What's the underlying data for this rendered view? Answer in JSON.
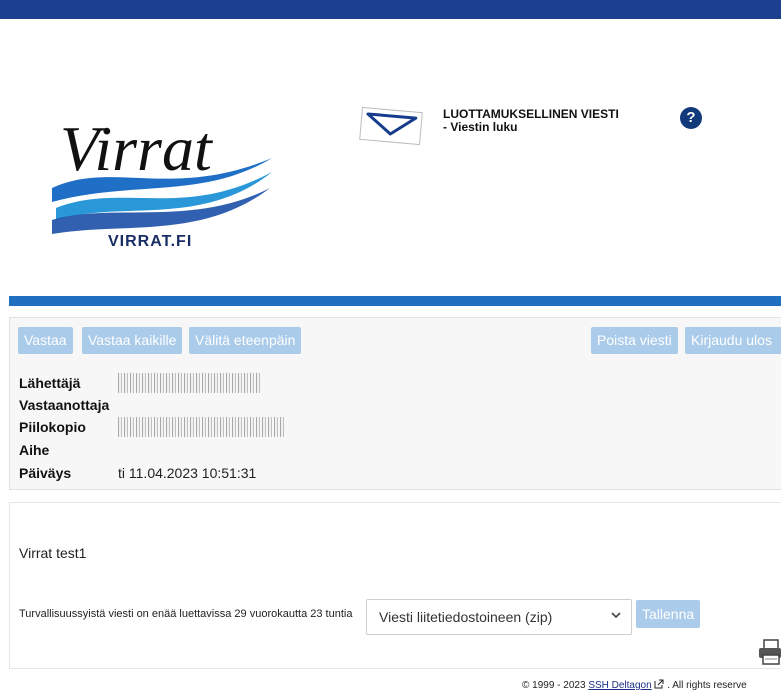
{
  "header": {
    "logo_script": "Virrat",
    "logo_domain": "VIRRAT.FI",
    "title_line1": "LUOTTAMUKSELLINEN VIESTI",
    "title_line2": "- Viestin luku",
    "help_label": "?"
  },
  "toolbar": {
    "reply": "Vastaa",
    "reply_all": "Vastaa kaikille",
    "forward": "Välitä eteenpäin",
    "delete": "Poista viesti",
    "logout": "Kirjaudu ulos"
  },
  "fields": {
    "sender_label": "Lähettäjä",
    "recipient_label": "Vastaanottaja",
    "bcc_label": "Piilokopio",
    "subject_label": "Aihe",
    "date_label": "Päiväys",
    "date_value": "ti 11.04.2023 10:51:31"
  },
  "message": {
    "body": "Virrat test1",
    "expiry_notice": "Turvallisuussyistä viesti on enää luettavissa 29 vuorokautta 23 tuntia"
  },
  "download": {
    "selected_option": "Viesti liitetiedostoineen (zip)",
    "save_label": "Tallenna"
  },
  "footer": {
    "copyright": "© 1999 - 2023",
    "company_link": "SSH Deltagon",
    "rights": "All rights reserve"
  },
  "colors": {
    "top_bar": "#1d3f8f",
    "divider": "#1f70c0",
    "button_bg": "#aacbe9",
    "help_icon": "#123a7a"
  },
  "icons": [
    "envelope-icon",
    "help-icon",
    "chevron-down-icon",
    "printer-icon",
    "external-link-icon"
  ]
}
